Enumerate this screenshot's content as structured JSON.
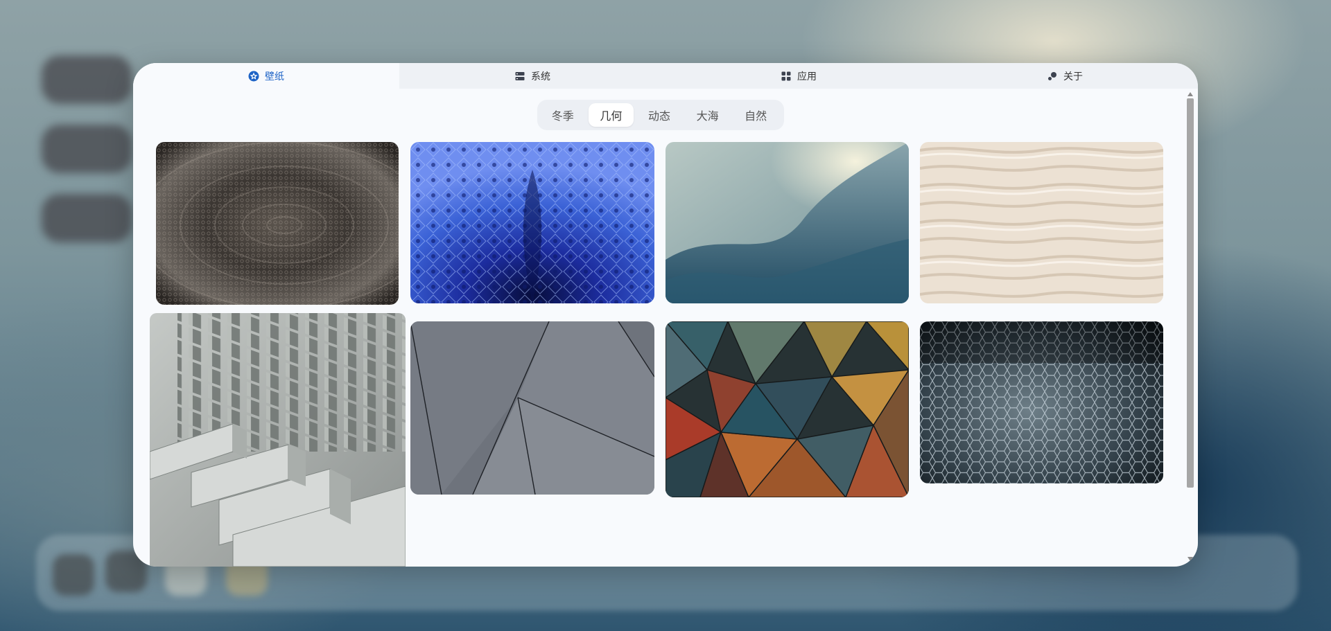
{
  "tabs": [
    {
      "label": "壁纸",
      "icon": "wallpaper-icon",
      "active": true
    },
    {
      "label": "系统",
      "icon": "system-icon",
      "active": false
    },
    {
      "label": "应用",
      "icon": "apps-grid-icon",
      "active": false
    },
    {
      "label": "关于",
      "icon": "about-icon",
      "active": false
    }
  ],
  "categories": [
    {
      "label": "冬季",
      "active": false
    },
    {
      "label": "几何",
      "active": true
    },
    {
      "label": "动态",
      "active": false
    },
    {
      "label": "大海",
      "active": false
    },
    {
      "label": "自然",
      "active": false
    }
  ],
  "wallpapers": [
    {
      "subject": "dark woven metal radial pattern"
    },
    {
      "subject": "blue mosaic muqarnas ceiling"
    },
    {
      "subject": "abstract curved architecture teal"
    },
    {
      "subject": "cream wavy 3d wall panel"
    },
    {
      "subject": "grey stepped concrete structures",
      "hovered": true
    },
    {
      "subject": "grey angular metal panels"
    },
    {
      "subject": "colorful triangular glass mosaic"
    },
    {
      "subject": "dark hexagonal metallic mesh"
    }
  ],
  "colors": {
    "accent": "#1d63c6",
    "window_bg": "#f8fafd",
    "tab_bg": "#eef1f5"
  }
}
